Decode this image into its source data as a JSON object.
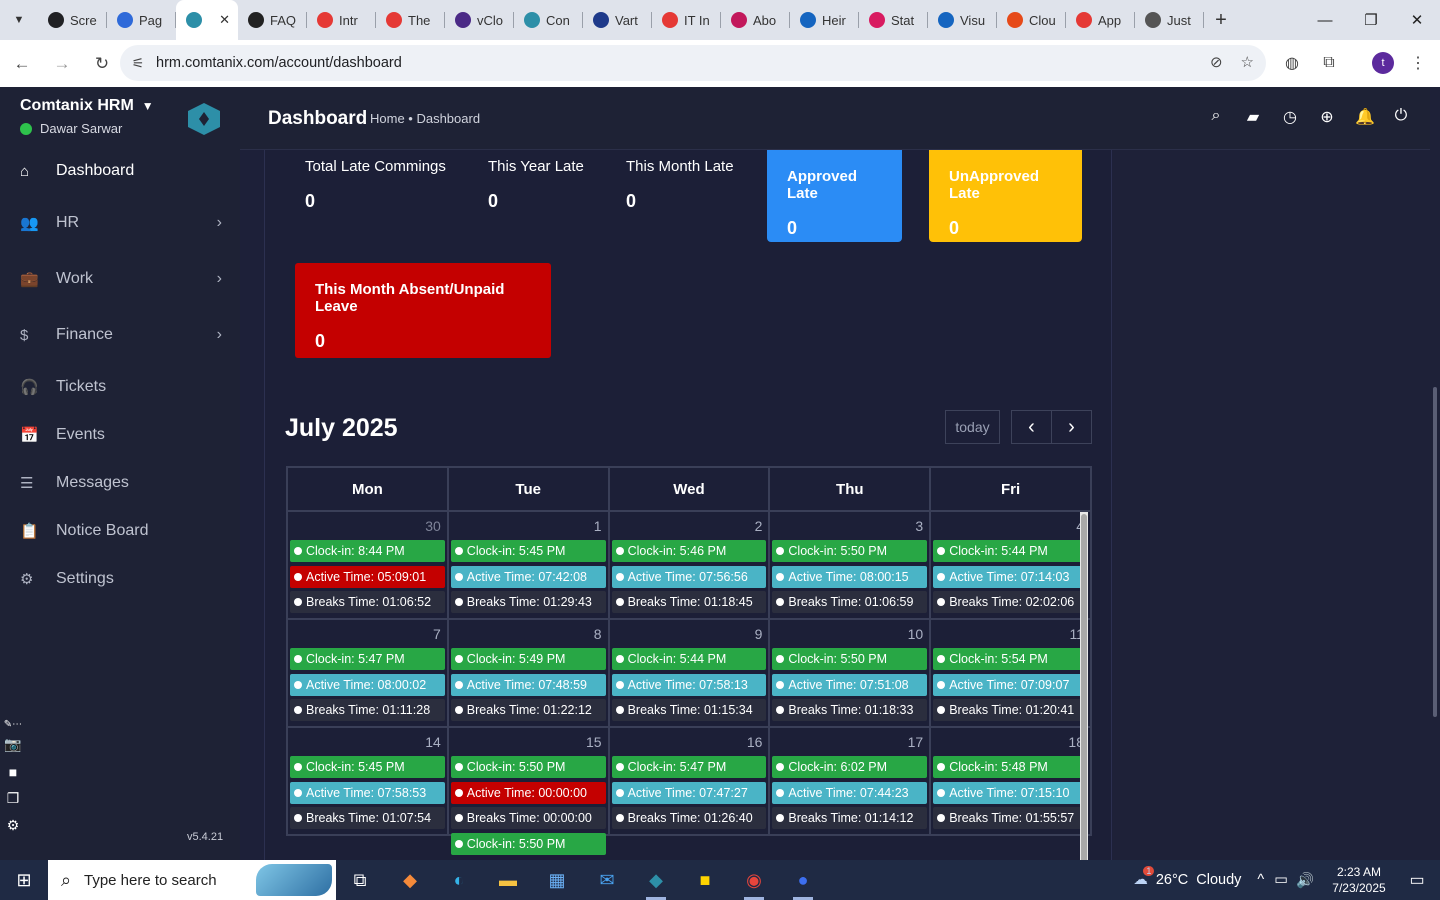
{
  "browser": {
    "tabs": [
      {
        "label": "Scre",
        "color": "#202124"
      },
      {
        "label": "Pag",
        "color": "#2f6ad9"
      },
      {
        "label": "",
        "color": "#2d8fa8",
        "active": true
      },
      {
        "label": "FAQ",
        "color": "#222222"
      },
      {
        "label": "Intr",
        "color": "#e53935"
      },
      {
        "label": "The",
        "color": "#e53935"
      },
      {
        "label": "vClo",
        "color": "#4b2a86"
      },
      {
        "label": "Con",
        "color": "#2d8fa8"
      },
      {
        "label": "Vart",
        "color": "#1e3a8a"
      },
      {
        "label": "IT In",
        "color": "#e53935"
      },
      {
        "label": "Abo",
        "color": "#c2185b"
      },
      {
        "label": "Heir",
        "color": "#1565c0"
      },
      {
        "label": "Stat",
        "color": "#d81b60"
      },
      {
        "label": "Visu",
        "color": "#1565c0"
      },
      {
        "label": "Clou",
        "color": "#e64a19"
      },
      {
        "label": "App",
        "color": "#e53935"
      },
      {
        "label": "Just",
        "color": "#555555"
      }
    ],
    "active_tab_close": "✕",
    "new_tab": "+",
    "url": "hrm.comtanix.com/account/dashboard",
    "profile_initial": "t"
  },
  "sidebar": {
    "company": "Comtanix HRM",
    "user": "Dawar Sarwar",
    "version": "v5.4.21",
    "items": [
      {
        "label": "Dashboard",
        "icon": "⌂",
        "active": true,
        "chevron": false
      },
      {
        "label": "HR",
        "icon": "👥",
        "chevron": true
      },
      {
        "label": "Work",
        "icon": "💼",
        "chevron": true
      },
      {
        "label": "Finance",
        "icon": "$",
        "chevron": true
      },
      {
        "label": "Tickets",
        "icon": "🎧",
        "chevron": false
      },
      {
        "label": "Events",
        "icon": "📅",
        "chevron": false
      },
      {
        "label": "Messages",
        "icon": "☰",
        "chevron": false
      },
      {
        "label": "Notice Board",
        "icon": "📋",
        "chevron": false
      },
      {
        "label": "Settings",
        "icon": "⚙",
        "chevron": false
      }
    ]
  },
  "header": {
    "title": "Dashboard",
    "breadcrumb": "Home • Dashboard"
  },
  "stats": {
    "total_late_label": "Total Late Commings",
    "total_late_value": "0",
    "year_late_label": "This Year Late",
    "year_late_value": "0",
    "month_late_label": "This Month Late",
    "month_late_value": "0",
    "approved_label": "Approved Late",
    "approved_value": "0",
    "unapproved_label": "UnApproved Late",
    "unapproved_value": "0",
    "absent_label": "This Month Absent/Unpaid Leave",
    "absent_value": "0",
    "colors": {
      "approved": "#2b8cf5",
      "unapproved": "#ffc107",
      "absent": "#c40000"
    }
  },
  "calendar": {
    "month": "July 2025",
    "today_label": "today",
    "prev": "‹",
    "next": "›",
    "days": [
      "Mon",
      "Tue",
      "Wed",
      "Thu",
      "Fri"
    ],
    "weeks": [
      [
        {
          "num": "30",
          "other": true,
          "events": [
            [
              "green",
              "Clock-in: 8:44 PM"
            ],
            [
              "red",
              "Active Time: 05:09:01"
            ],
            [
              "dark",
              "Breaks Time: 01:06:52"
            ]
          ]
        },
        {
          "num": "1",
          "events": [
            [
              "green",
              "Clock-in: 5:45 PM"
            ],
            [
              "teal",
              "Active Time: 07:42:08"
            ],
            [
              "dark",
              "Breaks Time: 01:29:43"
            ]
          ]
        },
        {
          "num": "2",
          "events": [
            [
              "green",
              "Clock-in: 5:46 PM"
            ],
            [
              "teal",
              "Active Time: 07:56:56"
            ],
            [
              "dark",
              "Breaks Time: 01:18:45"
            ]
          ]
        },
        {
          "num": "3",
          "events": [
            [
              "green",
              "Clock-in: 5:50 PM"
            ],
            [
              "teal",
              "Active Time: 08:00:15"
            ],
            [
              "dark",
              "Breaks Time: 01:06:59"
            ]
          ]
        },
        {
          "num": "4",
          "events": [
            [
              "green",
              "Clock-in: 5:44 PM"
            ],
            [
              "teal",
              "Active Time: 07:14:03"
            ],
            [
              "dark",
              "Breaks Time: 02:02:06"
            ]
          ]
        }
      ],
      [
        {
          "num": "7",
          "events": [
            [
              "green",
              "Clock-in: 5:47 PM"
            ],
            [
              "teal",
              "Active Time: 08:00:02"
            ],
            [
              "dark",
              "Breaks Time: 01:11:28"
            ]
          ]
        },
        {
          "num": "8",
          "events": [
            [
              "green",
              "Clock-in: 5:49 PM"
            ],
            [
              "teal",
              "Active Time: 07:48:59"
            ],
            [
              "dark",
              "Breaks Time: 01:22:12"
            ]
          ]
        },
        {
          "num": "9",
          "events": [
            [
              "green",
              "Clock-in: 5:44 PM"
            ],
            [
              "teal",
              "Active Time: 07:58:13"
            ],
            [
              "dark",
              "Breaks Time: 01:15:34"
            ]
          ]
        },
        {
          "num": "10",
          "events": [
            [
              "green",
              "Clock-in: 5:50 PM"
            ],
            [
              "teal",
              "Active Time: 07:51:08"
            ],
            [
              "dark",
              "Breaks Time: 01:18:33"
            ]
          ]
        },
        {
          "num": "11",
          "events": [
            [
              "green",
              "Clock-in: 5:54 PM"
            ],
            [
              "teal",
              "Active Time: 07:09:07"
            ],
            [
              "dark",
              "Breaks Time: 01:20:41"
            ]
          ]
        }
      ],
      [
        {
          "num": "14",
          "events": [
            [
              "green",
              "Clock-in: 5:45 PM"
            ],
            [
              "teal",
              "Active Time: 07:58:53"
            ],
            [
              "dark",
              "Breaks Time: 01:07:54"
            ]
          ]
        },
        {
          "num": "15",
          "events": [
            [
              "green",
              "Clock-in: 5:50 PM"
            ],
            [
              "red",
              "Active Time: 00:00:00"
            ],
            [
              "dark",
              "Breaks Time: 00:00:00"
            ],
            [
              "green",
              "Clock-in: 5:50 PM"
            ]
          ]
        },
        {
          "num": "16",
          "events": [
            [
              "green",
              "Clock-in: 5:47 PM"
            ],
            [
              "teal",
              "Active Time: 07:47:27"
            ],
            [
              "dark",
              "Breaks Time: 01:26:40"
            ]
          ]
        },
        {
          "num": "17",
          "events": [
            [
              "green",
              "Clock-in: 6:02 PM"
            ],
            [
              "teal",
              "Active Time: 07:44:23"
            ],
            [
              "dark",
              "Breaks Time: 01:14:12"
            ]
          ]
        },
        {
          "num": "18",
          "events": [
            [
              "green",
              "Clock-in: 5:48 PM"
            ],
            [
              "teal",
              "Active Time: 07:15:10"
            ],
            [
              "dark",
              "Breaks Time: 01:55:57"
            ]
          ]
        }
      ]
    ]
  },
  "taskbar": {
    "search_placeholder": "Type here to search",
    "weather": "26°C  Cloudy",
    "weather_badge": "1",
    "time": "2:23 AM",
    "date": "7/23/2025"
  }
}
